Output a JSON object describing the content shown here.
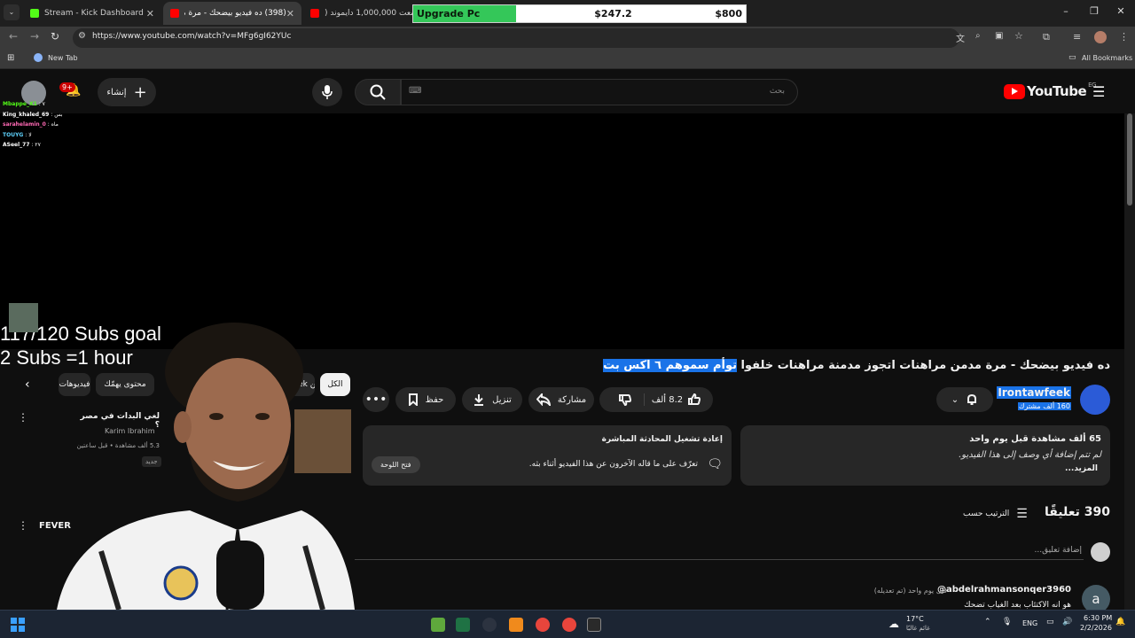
{
  "browser": {
    "tabs": [
      {
        "title": "Stream - Kick Dashboard",
        "active": false
      },
      {
        "title": "(398) ده فيديو بيضحك - مرة مد",
        "active": true
      },
      {
        "title": "جمعت 1,000,000 دايموند (",
        "active": false
      }
    ],
    "url": "https://www.youtube.com/watch?v=MFg6gI62YUc",
    "bookmarks": {
      "new_tab": "New Tab",
      "all_bookmarks": "All Bookmarks"
    }
  },
  "upgrade_overlay": {
    "label": "Upgrade Pc",
    "current": "$247.2",
    "goal": "$800",
    "progress": 0.309
  },
  "youtube": {
    "logo_text": "YouTube",
    "region": "EG",
    "search_placeholder": "بحث",
    "create_label": "إنشاء",
    "notif_badge": "9+"
  },
  "stream_overlay": {
    "goal_line1": "117/120 Subs goal",
    "goal_line2": "2 Subs =1 hour",
    "chat": [
      {
        "user": "Mbappe_X1",
        "msg": "٧"
      },
      {
        "user": "King_khaled_69",
        "msg": "بس"
      },
      {
        "user": "sarahelamin_0",
        "msg": "ماه"
      },
      {
        "user": "TOUYG",
        "msg": "لا"
      },
      {
        "user": "ASeel_77",
        "msg": "٢٧"
      }
    ]
  },
  "video": {
    "title_plain": "ده فيديو بيضحك - مرة مدمن مراهنات اتجوز مدمنة مراهنات خلفوا ",
    "title_highlight": "توأم سموهم ٦ اكس بت",
    "channel_name": "Irontawfeek",
    "subscribers": "160 ألف مشترك",
    "likes": "8.2 ألف",
    "share_label": "مشاركة",
    "download_label": "تنزيل",
    "save_label": "حفظ",
    "views_info": "65 ألف مشاهدة  قبل يوم واحد",
    "description": "لم تتم إضافة أي وصف إلى هذا الفيديو.",
    "more_label": "...المزيد",
    "live_replay_title": "إعادة تشغيل المحادثة المباشرة",
    "live_replay_desc": "تعرّف على ما قاله الآخرون عن هذا الفيديو أثناء بثه.",
    "open_panel_label": "فتح اللوحة"
  },
  "chips": [
    {
      "label": "الكل",
      "selected": true
    },
    {
      "label": "من Irontawfeek",
      "selected": false
    },
    {
      "label": "محتوى يهمّك",
      "selected": false
    },
    {
      "label": "فيديوهات",
      "selected": false
    }
  ],
  "sidebar_videos": [
    {
      "title": "لغي البدات في مصر ؟",
      "channel": "Karim Ibrahim",
      "meta": "5.3 ألف مشاهدة • قبل ساعتين",
      "badge": "جديد"
    },
    {
      "title": "FEVER",
      "channel": "",
      "meta": "",
      "badge": ""
    }
  ],
  "comments": {
    "count": "390 تعليقًا",
    "sort_label": "الترتيب حسب",
    "add_placeholder": "إضافة تعليق...",
    "first": {
      "author": "@abdelrahmansonqer3960",
      "meta": "قبل يوم واحد (تم تعديله)",
      "avatar_letter": "a",
      "text": "هو انه الاكتئاب بعد الغياب تضحك"
    }
  },
  "taskbar": {
    "weather_temp": "17°C",
    "weather_desc": "غائم غالبًا",
    "lang": "ENG",
    "time": "6:30 PM",
    "date": "2/2/2026"
  }
}
